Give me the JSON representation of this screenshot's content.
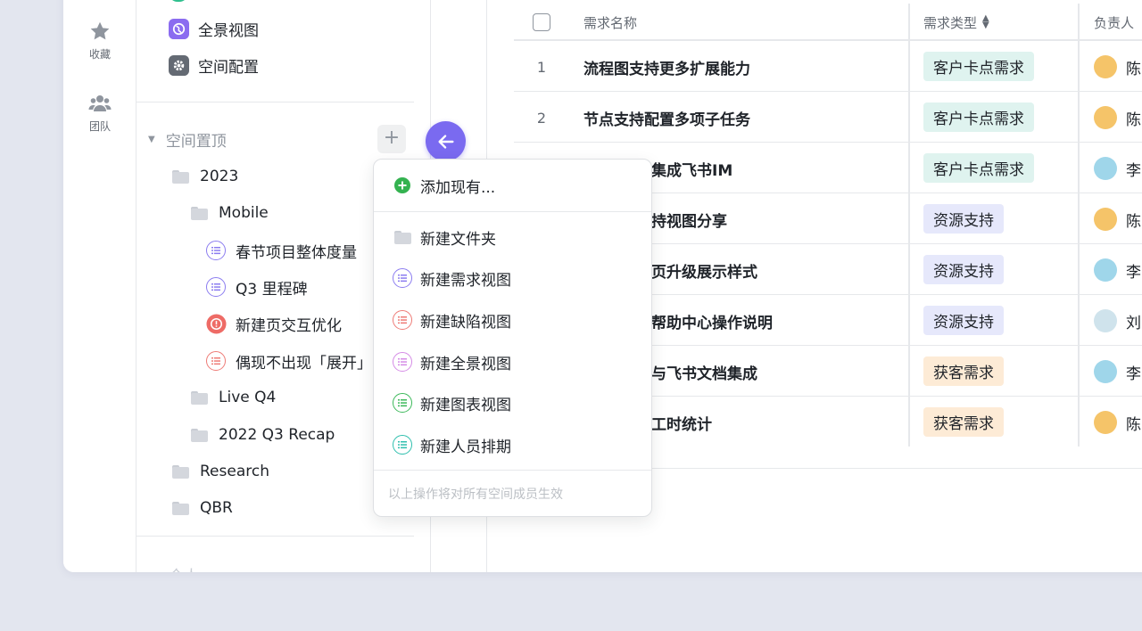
{
  "rail": {
    "favorites_label": "收藏",
    "team_label": "团队"
  },
  "tree": {
    "top_items": [
      {
        "label": "全景视图",
        "icon": "globe-icon"
      },
      {
        "label": "空间配置",
        "icon": "gear-icon"
      }
    ],
    "pinned_section_title": "空间置顶",
    "items": {
      "f2023": "2023",
      "mobile": "Mobile",
      "spring": "春节项目整体度量",
      "q3": "Q3 里程碑",
      "newpage": "新建页交互优化",
      "occasional": "偶现不出现「展开」",
      "live": "Live Q4",
      "recap": "2022 Q3 Recap",
      "research": "Research",
      "qbr": "QBR"
    },
    "personal_section_title": "个人"
  },
  "menu": {
    "add_existing": "添加现有...",
    "new_folder": "新建文件夹",
    "new_requirement_view": "新建需求视图",
    "new_defect_view": "新建缺陷视图",
    "new_panorama_view": "新建全景视图",
    "new_chart_view": "新建图表视图",
    "new_staff_schedule": "新建人员排期",
    "note": "以上操作将对所有空间成员生效"
  },
  "table": {
    "headers": {
      "name": "需求名称",
      "type": "需求类型",
      "owner": "负责人"
    },
    "rows": [
      {
        "num": "1",
        "name": "流程图支持更多扩展能力",
        "type": "客户卡点需求",
        "owner": "陈"
      },
      {
        "num": "2",
        "name": "节点支持配置多项子任务",
        "type": "客户卡点需求",
        "owner": "陈"
      },
      {
        "num": "3",
        "name": "集成飞书IM",
        "type": "客户卡点需求",
        "owner": "李"
      },
      {
        "num": "4",
        "name": "持视图分享",
        "type": "资源支持",
        "owner": "陈"
      },
      {
        "num": "5",
        "name": "页升级展示样式",
        "type": "资源支持",
        "owner": "李"
      },
      {
        "num": "6",
        "name": "帮助中心操作说明",
        "type": "资源支持",
        "owner": "刘"
      },
      {
        "num": "7",
        "name": "与飞书文档集成",
        "type": "获客需求",
        "owner": "李"
      },
      {
        "num": "8",
        "name": "工时统计",
        "type": "获客需求",
        "owner": "陈"
      }
    ]
  },
  "colors": {
    "accent": "#7a6af0",
    "tag_customer": "#dff3ef",
    "tag_resource": "#e6e8fb",
    "tag_acquire": "#fdebd6"
  }
}
